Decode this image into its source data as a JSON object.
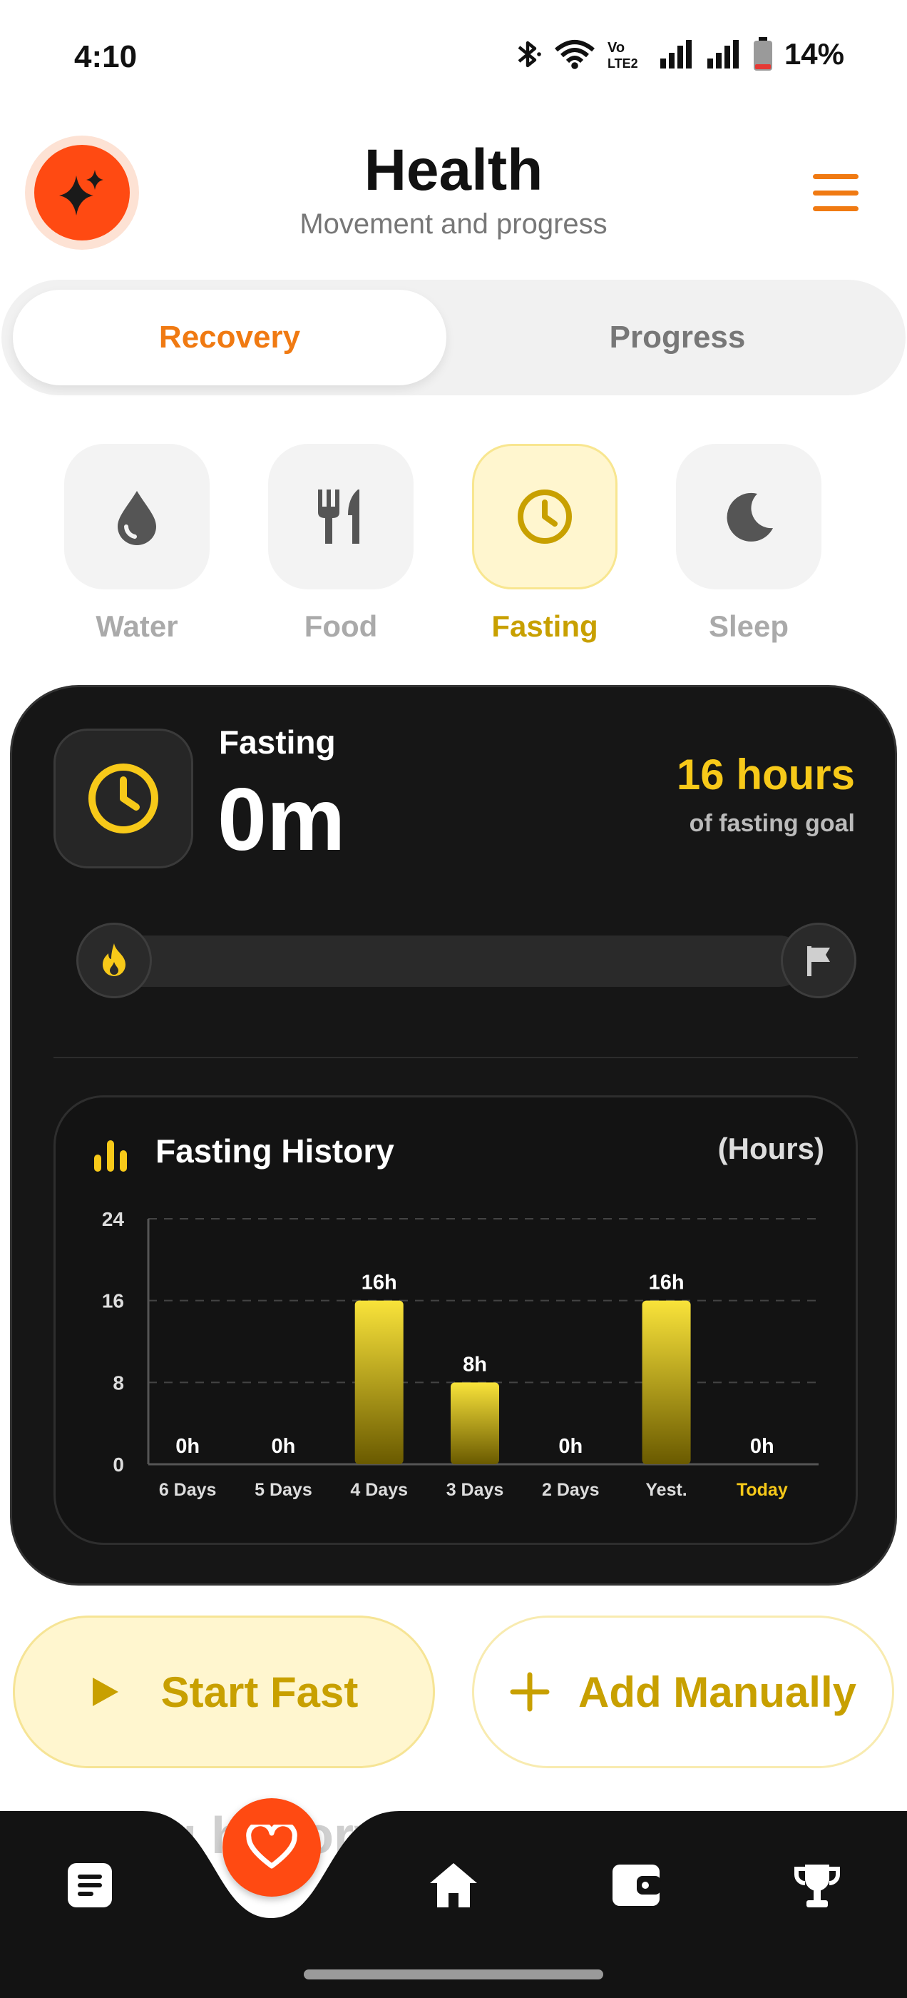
{
  "status_bar": {
    "time": "4:10",
    "battery": "14%",
    "icons": [
      "bluetooth-icon",
      "wifi-icon",
      "volte-icon",
      "signal-icon",
      "signal-icon",
      "battery-icon"
    ]
  },
  "header": {
    "title": "Health",
    "subtitle": "Movement and progress",
    "avatar_icon": "sparkles-icon",
    "menu_icon": "hamburger-menu-icon"
  },
  "tabs": [
    {
      "label": "Recovery",
      "active": true
    },
    {
      "label": "Progress",
      "active": false
    }
  ],
  "categories": [
    {
      "label": "Water",
      "icon": "water-drop-icon",
      "active": false
    },
    {
      "label": "Food",
      "icon": "fork-knife-icon",
      "active": false
    },
    {
      "label": "Fasting",
      "icon": "clock-icon",
      "active": true
    },
    {
      "label": "Sleep",
      "icon": "moon-icon",
      "active": false
    }
  ],
  "fasting_card": {
    "label": "Fasting",
    "elapsed": "0m",
    "goal": "16 hours",
    "goal_caption": "of fasting goal",
    "progress_fraction": 0,
    "start_icon": "flame-icon",
    "end_icon": "flag-icon"
  },
  "history": {
    "title": "Fasting History",
    "unit": "(Hours)"
  },
  "chart_data": {
    "type": "bar",
    "title": "Fasting History",
    "unit": "(Hours)",
    "categories": [
      "6 Days",
      "5 Days",
      "4 Days",
      "3 Days",
      "2 Days",
      "Yest.",
      "Today"
    ],
    "values": [
      0,
      0,
      16,
      8,
      0,
      16,
      0
    ],
    "value_labels": [
      "0h",
      "0h",
      "16h",
      "8h",
      "0h",
      "16h",
      "0h"
    ],
    "yticks": [
      "0",
      "8",
      "16",
      "24"
    ],
    "ylim": [
      0,
      24
    ],
    "grid": true,
    "highlight_category": "Today",
    "colors": {
      "bar_top": "#f9e33a",
      "bar_bottom": "#6a5a00",
      "highlight": "#f7c919",
      "grid": "#444444"
    }
  },
  "actions": {
    "start_label": "Start Fast",
    "add_label": "Add Manually"
  },
  "peek_text": "g history",
  "bottom_nav": {
    "items": [
      "notes-icon",
      "heart-icon",
      "home-icon",
      "wallet-icon",
      "trophy-icon"
    ]
  },
  "colors": {
    "accent_orange": "#f07a12",
    "accent_red": "#ff4a12",
    "accent_yellow": "#f7c919",
    "dark_card": "#161616"
  }
}
